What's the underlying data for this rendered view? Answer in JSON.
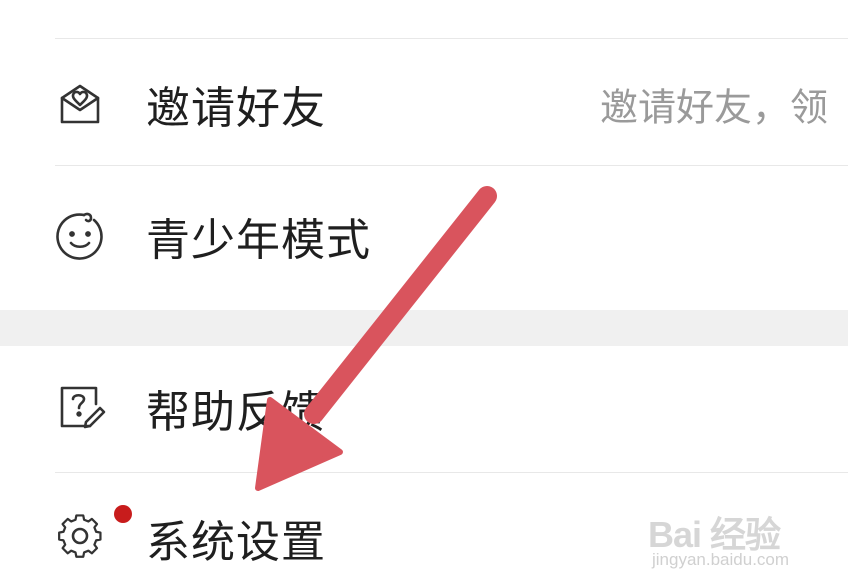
{
  "menu": {
    "items": [
      {
        "label": "邀请好友",
        "hint": "邀请好友，领",
        "icon": "envelope-heart-icon"
      },
      {
        "label": "青少年模式",
        "icon": "baby-face-icon"
      },
      {
        "label": "帮助反馈",
        "icon": "help-edit-icon"
      },
      {
        "label": "系统设置",
        "icon": "gear-icon",
        "has_notification_dot": true
      }
    ]
  },
  "watermark": {
    "main": "Bai 经验",
    "sub": "jingyan.baidu.com"
  },
  "colors": {
    "arrow": "#d9545d",
    "notification_dot": "#c81c1c",
    "divider": "#e8e8e8",
    "section_gap": "#f0f0f0"
  }
}
